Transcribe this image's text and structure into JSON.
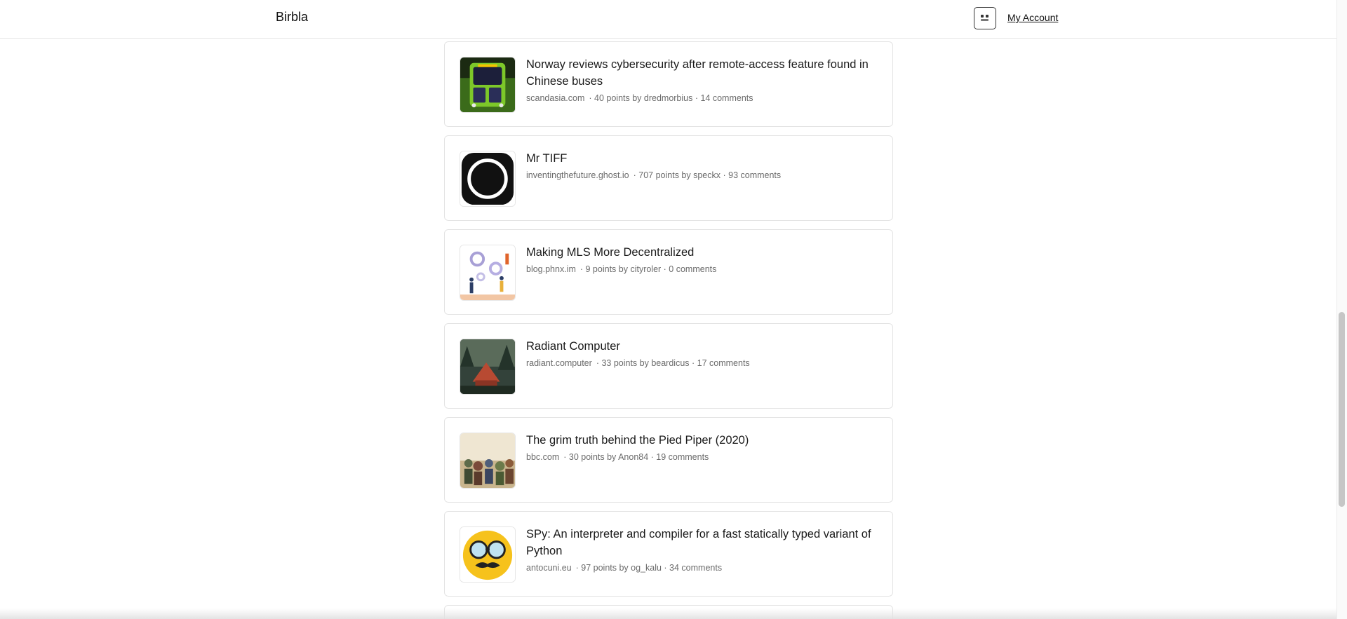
{
  "header": {
    "brand": "Birbla",
    "apps_icon": "grid-icon",
    "account_label": "My Account"
  },
  "stories": [
    {
      "title": "Norway reviews cybersecurity after remote-access feature found in Chinese buses",
      "domain": "scandasia.com",
      "stats": "· 40 points by dredmorbius · 14 comments",
      "thumb": "green-bus"
    },
    {
      "title": "Mr TIFF",
      "domain": "inventingthefuture.ghost.io",
      "stats": "· 707 points by speckx · 93 comments",
      "thumb": "black-circle"
    },
    {
      "title": "Making MLS More Decentralized",
      "domain": "blog.phnx.im",
      "stats": "· 9 points by cityroler · 0 comments",
      "thumb": "gears-illustration"
    },
    {
      "title": "Radiant Computer",
      "domain": "radiant.computer",
      "stats": "· 33 points by beardicus · 17 comments",
      "thumb": "forest-cabin"
    },
    {
      "title": "The grim truth behind the Pied Piper (2020)",
      "domain": "bbc.com",
      "stats": "· 30 points by Anon84 · 19 comments",
      "thumb": "crowd-painting"
    },
    {
      "title": "SPy: An interpreter and compiler for a fast statically typed variant of Python",
      "domain": "antocuni.eu",
      "stats": "· 97 points by og_kalu · 34 comments",
      "thumb": "disguise-emoji"
    }
  ]
}
